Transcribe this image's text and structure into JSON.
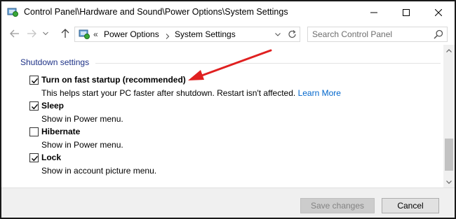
{
  "window": {
    "title": "Control Panel\\Hardware and Sound\\Power Options\\System Settings",
    "icon": "control-panel-icon"
  },
  "nav": {
    "address_prefix": "«",
    "breadcrumbs": [
      "Power Options",
      "System Settings"
    ],
    "search_placeholder": "Search Control Panel"
  },
  "content": {
    "section_title": "Shutdown settings",
    "options": [
      {
        "label": "Turn on fast startup (recommended)",
        "checked": true,
        "description": "This helps start your PC faster after shutdown. Restart isn't affected.",
        "link": "Learn More"
      },
      {
        "label": "Sleep",
        "checked": true,
        "description": "Show in Power menu."
      },
      {
        "label": "Hibernate",
        "checked": false,
        "description": "Show in Power menu."
      },
      {
        "label": "Lock",
        "checked": true,
        "description": "Show in account picture menu."
      }
    ]
  },
  "footer": {
    "save_label": "Save changes",
    "cancel_label": "Cancel"
  },
  "colors": {
    "section_header": "#1e3287",
    "link": "#0066cc",
    "annotation_arrow": "#e02020"
  }
}
